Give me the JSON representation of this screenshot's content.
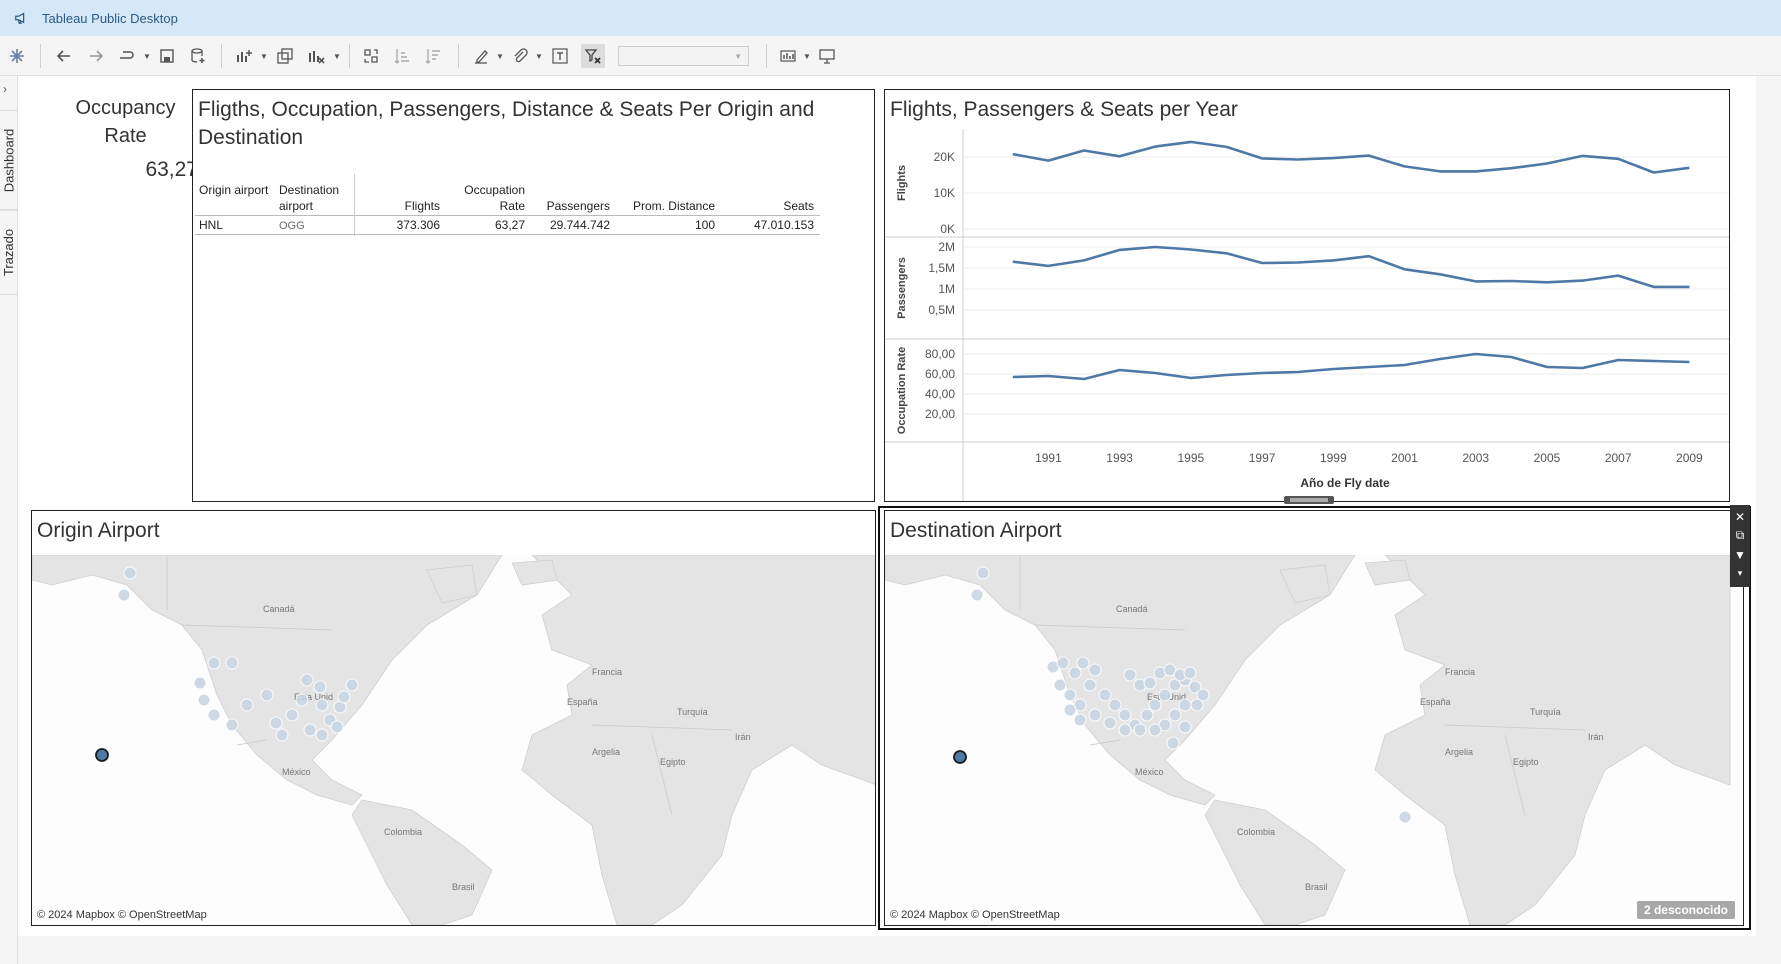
{
  "window": {
    "title": "Tableau Public Desktop"
  },
  "toolbar": {
    "icons": [
      "tableau-logo-icon",
      "undo-icon",
      "redo-icon",
      "redo-dropdown-icon",
      "save-icon",
      "new-datasource-icon",
      "new-worksheet-icon",
      "duplicate-sheet-icon",
      "clear-sheet-icon",
      "swap-axes-icon",
      "sort-ascending-icon",
      "sort-descending-icon",
      "highlight-icon",
      "group-icon",
      "show-labels-icon",
      "clear-filters-icon",
      "fit-select",
      "show-me-icon",
      "presentation-icon"
    ],
    "fit_select_value": ""
  },
  "left_tabs": {
    "dashboard": "Dashboard",
    "layout": "Trazado"
  },
  "kpi": {
    "title": "Occupancy Rate",
    "value": "63,27"
  },
  "table_panel": {
    "title": "Fligths, Occupation, Passengers, Distance & Seats Per Origin and Destination",
    "headers": {
      "origin": "Origin airport",
      "destination": "Destination airport",
      "flights": "Flights",
      "occupation": "Occupation Rate",
      "passengers": "Passengers",
      "distance": "Prom. Distance",
      "seats": "Seats"
    },
    "rows": [
      {
        "origin": "HNL",
        "destination": "OGG",
        "flights": "373.306",
        "occupation": "63,27",
        "passengers": "29.744.742",
        "distance": "100",
        "seats": "47.010.153"
      }
    ]
  },
  "line_panel": {
    "title": "Flights, Passengers & Seats per Year"
  },
  "chart_data": {
    "type": "line",
    "title": "Flights, Passengers & Seats per Year",
    "xlabel": "Año de Fly date",
    "x": [
      1990,
      1991,
      1992,
      1993,
      1994,
      1995,
      1996,
      1997,
      1998,
      1999,
      2000,
      2001,
      2002,
      2003,
      2004,
      2005,
      2006,
      2007,
      2008,
      2009
    ],
    "x_ticks": [
      "1991",
      "1993",
      "1995",
      "1997",
      "1999",
      "2001",
      "2003",
      "2005",
      "2007",
      "2009"
    ],
    "series": [
      {
        "name": "Flights",
        "ylim": [
          0,
          25000
        ],
        "ticks": [
          "0K",
          "10K",
          "20K"
        ],
        "tick_values": [
          0,
          10000,
          20000
        ],
        "values": [
          20800,
          19000,
          21800,
          20200,
          22900,
          24200,
          22800,
          19600,
          19300,
          19700,
          20400,
          17400,
          16000,
          16000,
          16900,
          18200,
          20300,
          19500,
          15700,
          17000
        ]
      },
      {
        "name": "Passengers",
        "ylim": [
          0,
          2000000
        ],
        "ticks": [
          "0,5M",
          "1M",
          "1,5M",
          "2M"
        ],
        "tick_values": [
          500000,
          1000000,
          1500000,
          2000000
        ],
        "values": [
          1650000,
          1550000,
          1680000,
          1930000,
          2000000,
          1940000,
          1850000,
          1620000,
          1630000,
          1680000,
          1780000,
          1470000,
          1350000,
          1180000,
          1190000,
          1160000,
          1200000,
          1320000,
          1050000,
          1050000
        ]
      },
      {
        "name": "Occupation Rate",
        "ylim": [
          0,
          85
        ],
        "ticks": [
          "20,00",
          "40,00",
          "60,00",
          "80,00"
        ],
        "tick_values": [
          20,
          40,
          60,
          80
        ],
        "values": [
          57,
          58,
          55,
          64,
          61,
          56,
          59,
          61,
          62,
          65,
          67,
          69,
          75,
          80,
          77,
          67,
          66,
          74,
          73,
          72
        ]
      }
    ],
    "grid": true
  },
  "origin_map": {
    "title": "Origin Airport",
    "credit": "© 2024 Mapbox © OpenStreetMap"
  },
  "destination_map": {
    "title": "Destination Airport",
    "credit": "© 2024 Mapbox © OpenStreetMap",
    "unknown": "2 desconocido"
  },
  "map_labels": {
    "canada": "Canadá",
    "usa": "Esta Unid",
    "mexico": "México",
    "colombia": "Colombia",
    "brasil": "Brasil",
    "espana": "España",
    "francia": "Francia",
    "turquia": "Turquía",
    "argelia": "Argelia",
    "egipto": "Egipto",
    "iran": "Irán"
  },
  "float_toolbar": {
    "icons": [
      "close-icon",
      "popout-icon",
      "filter-icon",
      "more-icon"
    ]
  }
}
